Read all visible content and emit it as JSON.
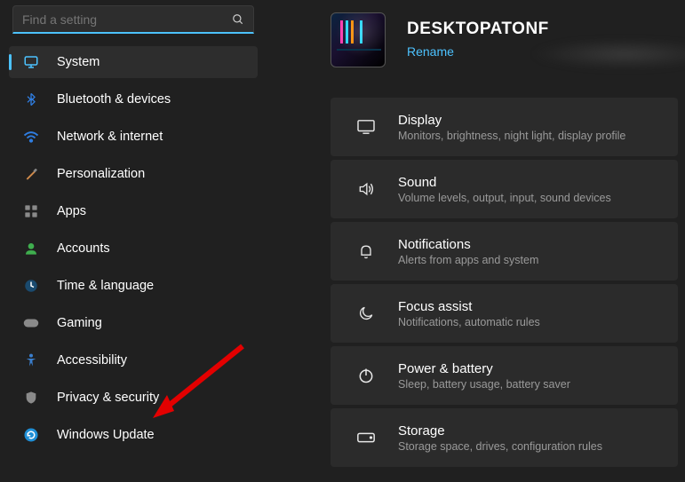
{
  "search": {
    "placeholder": "Find a setting"
  },
  "sidebar": {
    "items": [
      {
        "label": "System"
      },
      {
        "label": "Bluetooth & devices"
      },
      {
        "label": "Network & internet"
      },
      {
        "label": "Personalization"
      },
      {
        "label": "Apps"
      },
      {
        "label": "Accounts"
      },
      {
        "label": "Time & language"
      },
      {
        "label": "Gaming"
      },
      {
        "label": "Accessibility"
      },
      {
        "label": "Privacy & security"
      },
      {
        "label": "Windows Update"
      }
    ]
  },
  "header": {
    "pcname": "DESKTOPATONF",
    "rename": "Rename"
  },
  "cards": [
    {
      "title": "Display",
      "sub": "Monitors, brightness, night light, display profile"
    },
    {
      "title": "Sound",
      "sub": "Volume levels, output, input, sound devices"
    },
    {
      "title": "Notifications",
      "sub": "Alerts from apps and system"
    },
    {
      "title": "Focus assist",
      "sub": "Notifications, automatic rules"
    },
    {
      "title": "Power & battery",
      "sub": "Sleep, battery usage, battery saver"
    },
    {
      "title": "Storage",
      "sub": "Storage space, drives, configuration rules"
    }
  ]
}
